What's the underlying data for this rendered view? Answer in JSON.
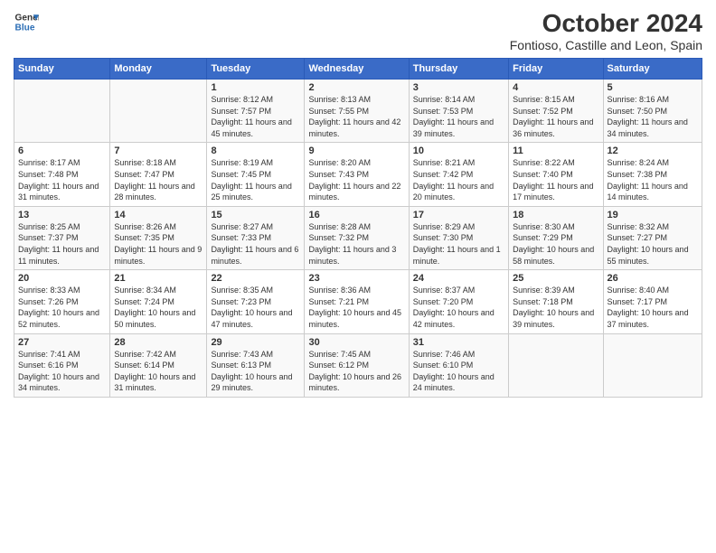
{
  "header": {
    "logo_line1": "General",
    "logo_line2": "Blue",
    "title": "October 2024",
    "subtitle": "Fontioso, Castille and Leon, Spain"
  },
  "days_of_week": [
    "Sunday",
    "Monday",
    "Tuesday",
    "Wednesday",
    "Thursday",
    "Friday",
    "Saturday"
  ],
  "weeks": [
    [
      {
        "day": "",
        "info": ""
      },
      {
        "day": "",
        "info": ""
      },
      {
        "day": "1",
        "info": "Sunrise: 8:12 AM\nSunset: 7:57 PM\nDaylight: 11 hours and 45 minutes."
      },
      {
        "day": "2",
        "info": "Sunrise: 8:13 AM\nSunset: 7:55 PM\nDaylight: 11 hours and 42 minutes."
      },
      {
        "day": "3",
        "info": "Sunrise: 8:14 AM\nSunset: 7:53 PM\nDaylight: 11 hours and 39 minutes."
      },
      {
        "day": "4",
        "info": "Sunrise: 8:15 AM\nSunset: 7:52 PM\nDaylight: 11 hours and 36 minutes."
      },
      {
        "day": "5",
        "info": "Sunrise: 8:16 AM\nSunset: 7:50 PM\nDaylight: 11 hours and 34 minutes."
      }
    ],
    [
      {
        "day": "6",
        "info": "Sunrise: 8:17 AM\nSunset: 7:48 PM\nDaylight: 11 hours and 31 minutes."
      },
      {
        "day": "7",
        "info": "Sunrise: 8:18 AM\nSunset: 7:47 PM\nDaylight: 11 hours and 28 minutes."
      },
      {
        "day": "8",
        "info": "Sunrise: 8:19 AM\nSunset: 7:45 PM\nDaylight: 11 hours and 25 minutes."
      },
      {
        "day": "9",
        "info": "Sunrise: 8:20 AM\nSunset: 7:43 PM\nDaylight: 11 hours and 22 minutes."
      },
      {
        "day": "10",
        "info": "Sunrise: 8:21 AM\nSunset: 7:42 PM\nDaylight: 11 hours and 20 minutes."
      },
      {
        "day": "11",
        "info": "Sunrise: 8:22 AM\nSunset: 7:40 PM\nDaylight: 11 hours and 17 minutes."
      },
      {
        "day": "12",
        "info": "Sunrise: 8:24 AM\nSunset: 7:38 PM\nDaylight: 11 hours and 14 minutes."
      }
    ],
    [
      {
        "day": "13",
        "info": "Sunrise: 8:25 AM\nSunset: 7:37 PM\nDaylight: 11 hours and 11 minutes."
      },
      {
        "day": "14",
        "info": "Sunrise: 8:26 AM\nSunset: 7:35 PM\nDaylight: 11 hours and 9 minutes."
      },
      {
        "day": "15",
        "info": "Sunrise: 8:27 AM\nSunset: 7:33 PM\nDaylight: 11 hours and 6 minutes."
      },
      {
        "day": "16",
        "info": "Sunrise: 8:28 AM\nSunset: 7:32 PM\nDaylight: 11 hours and 3 minutes."
      },
      {
        "day": "17",
        "info": "Sunrise: 8:29 AM\nSunset: 7:30 PM\nDaylight: 11 hours and 1 minute."
      },
      {
        "day": "18",
        "info": "Sunrise: 8:30 AM\nSunset: 7:29 PM\nDaylight: 10 hours and 58 minutes."
      },
      {
        "day": "19",
        "info": "Sunrise: 8:32 AM\nSunset: 7:27 PM\nDaylight: 10 hours and 55 minutes."
      }
    ],
    [
      {
        "day": "20",
        "info": "Sunrise: 8:33 AM\nSunset: 7:26 PM\nDaylight: 10 hours and 52 minutes."
      },
      {
        "day": "21",
        "info": "Sunrise: 8:34 AM\nSunset: 7:24 PM\nDaylight: 10 hours and 50 minutes."
      },
      {
        "day": "22",
        "info": "Sunrise: 8:35 AM\nSunset: 7:23 PM\nDaylight: 10 hours and 47 minutes."
      },
      {
        "day": "23",
        "info": "Sunrise: 8:36 AM\nSunset: 7:21 PM\nDaylight: 10 hours and 45 minutes."
      },
      {
        "day": "24",
        "info": "Sunrise: 8:37 AM\nSunset: 7:20 PM\nDaylight: 10 hours and 42 minutes."
      },
      {
        "day": "25",
        "info": "Sunrise: 8:39 AM\nSunset: 7:18 PM\nDaylight: 10 hours and 39 minutes."
      },
      {
        "day": "26",
        "info": "Sunrise: 8:40 AM\nSunset: 7:17 PM\nDaylight: 10 hours and 37 minutes."
      }
    ],
    [
      {
        "day": "27",
        "info": "Sunrise: 7:41 AM\nSunset: 6:16 PM\nDaylight: 10 hours and 34 minutes."
      },
      {
        "day": "28",
        "info": "Sunrise: 7:42 AM\nSunset: 6:14 PM\nDaylight: 10 hours and 31 minutes."
      },
      {
        "day": "29",
        "info": "Sunrise: 7:43 AM\nSunset: 6:13 PM\nDaylight: 10 hours and 29 minutes."
      },
      {
        "day": "30",
        "info": "Sunrise: 7:45 AM\nSunset: 6:12 PM\nDaylight: 10 hours and 26 minutes."
      },
      {
        "day": "31",
        "info": "Sunrise: 7:46 AM\nSunset: 6:10 PM\nDaylight: 10 hours and 24 minutes."
      },
      {
        "day": "",
        "info": ""
      },
      {
        "day": "",
        "info": ""
      }
    ]
  ]
}
